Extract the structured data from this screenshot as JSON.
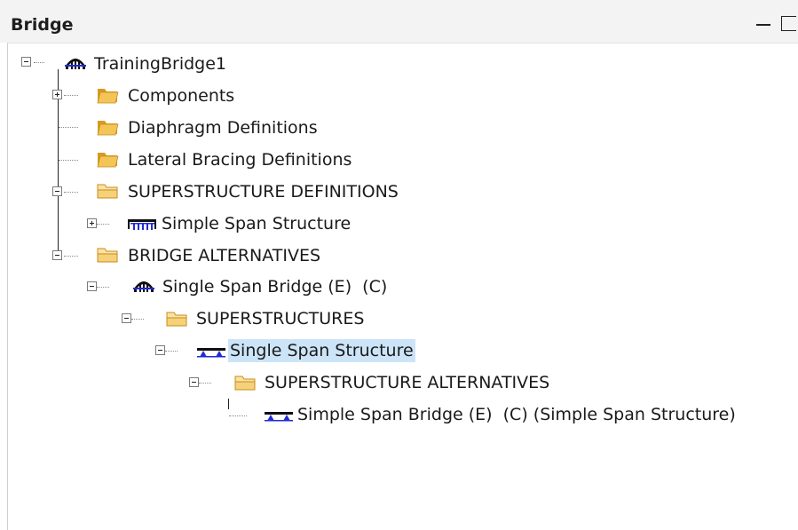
{
  "window": {
    "title": "Bridge"
  },
  "tree": {
    "root_label": "TrainingBridge1",
    "components_label": "Components",
    "diaphragm_label": "Diaphragm Definitions",
    "lateral_bracing_label": "Lateral Bracing Definitions",
    "superstructure_definitions_label": "SUPERSTRUCTURE DEFINITIONS",
    "simple_span_structure_label": "Simple Span Structure",
    "bridge_alternatives_label": "BRIDGE ALTERNATIVES",
    "single_span_bridge_label": "Single Span Bridge (E)  (C)",
    "superstructures_label": "SUPERSTRUCTURES",
    "single_span_structure_label": "Single Span Structure",
    "superstructure_alternatives_label": "SUPERSTRUCTURE ALTERNATIVES",
    "simple_span_bridge_label": "Simple Span Bridge (E)  (C) (Simple Span Structure)"
  },
  "icons": {
    "bridge": "bridge-arch-icon",
    "folder_closed": "folder-icon",
    "folder_open": "folder-open-icon",
    "girder_structure": "girder-structure-icon",
    "superstructure": "superstructure-icon"
  },
  "colors": {
    "selection": "#cce4f7",
    "icon_blue": "#1f2bd6",
    "folder": "#e8b04a"
  }
}
